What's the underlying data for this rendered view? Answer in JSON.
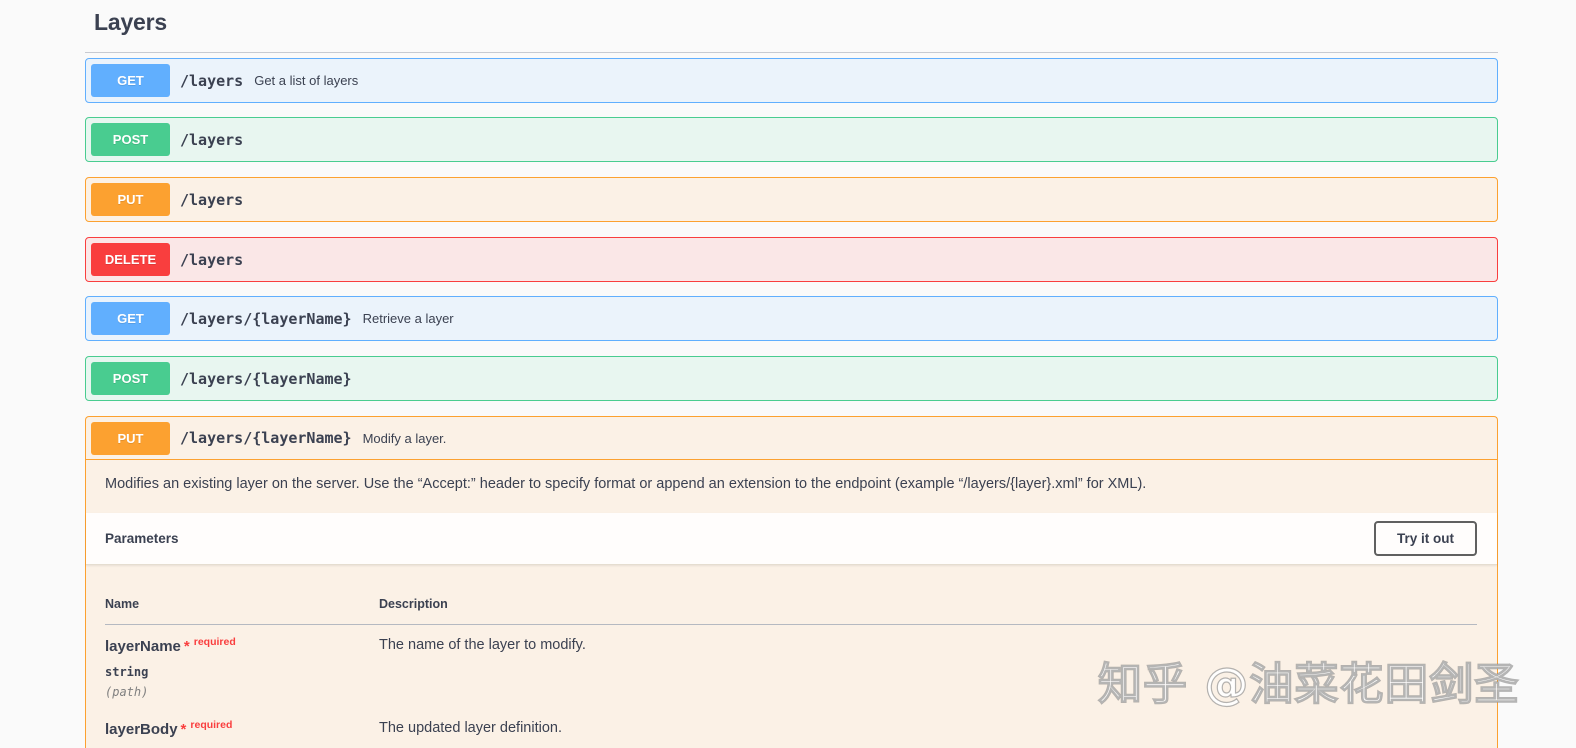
{
  "section": {
    "title": "Layers"
  },
  "operations": [
    {
      "method": "GET",
      "path": "/layers",
      "summary": "Get a list of layers"
    },
    {
      "method": "POST",
      "path": "/layers",
      "summary": ""
    },
    {
      "method": "PUT",
      "path": "/layers",
      "summary": ""
    },
    {
      "method": "DELETE",
      "path": "/layers",
      "summary": ""
    },
    {
      "method": "GET",
      "path": "/layers/{layerName}",
      "summary": "Retrieve a layer"
    },
    {
      "method": "POST",
      "path": "/layers/{layerName}",
      "summary": ""
    },
    {
      "method": "PUT",
      "path": "/layers/{layerName}",
      "summary": "Modify a layer."
    }
  ],
  "expanded": {
    "description": "Modifies an existing layer on the server. Use the “Accept:” header to specify format or append an extension to the endpoint (example “/layers/{layer}.xml” for XML).",
    "parameters_title": "Parameters",
    "try_it_out_label": "Try it out",
    "columns": {
      "name": "Name",
      "description": "Description"
    },
    "params": [
      {
        "name": "layerName",
        "star": "*",
        "required": "required",
        "type": "string",
        "in": "(path)",
        "description": "The name of the layer to modify."
      },
      {
        "name": "layerBody",
        "star": "*",
        "required": "required",
        "type": "",
        "in": "",
        "description": "The updated layer definition."
      }
    ]
  },
  "watermark": "知乎 @油菜花田剑圣",
  "colors": {
    "get": "#61affe",
    "post": "#49cc90",
    "put": "#fca130",
    "delete": "#f93e3e",
    "text": "#3b4151"
  }
}
